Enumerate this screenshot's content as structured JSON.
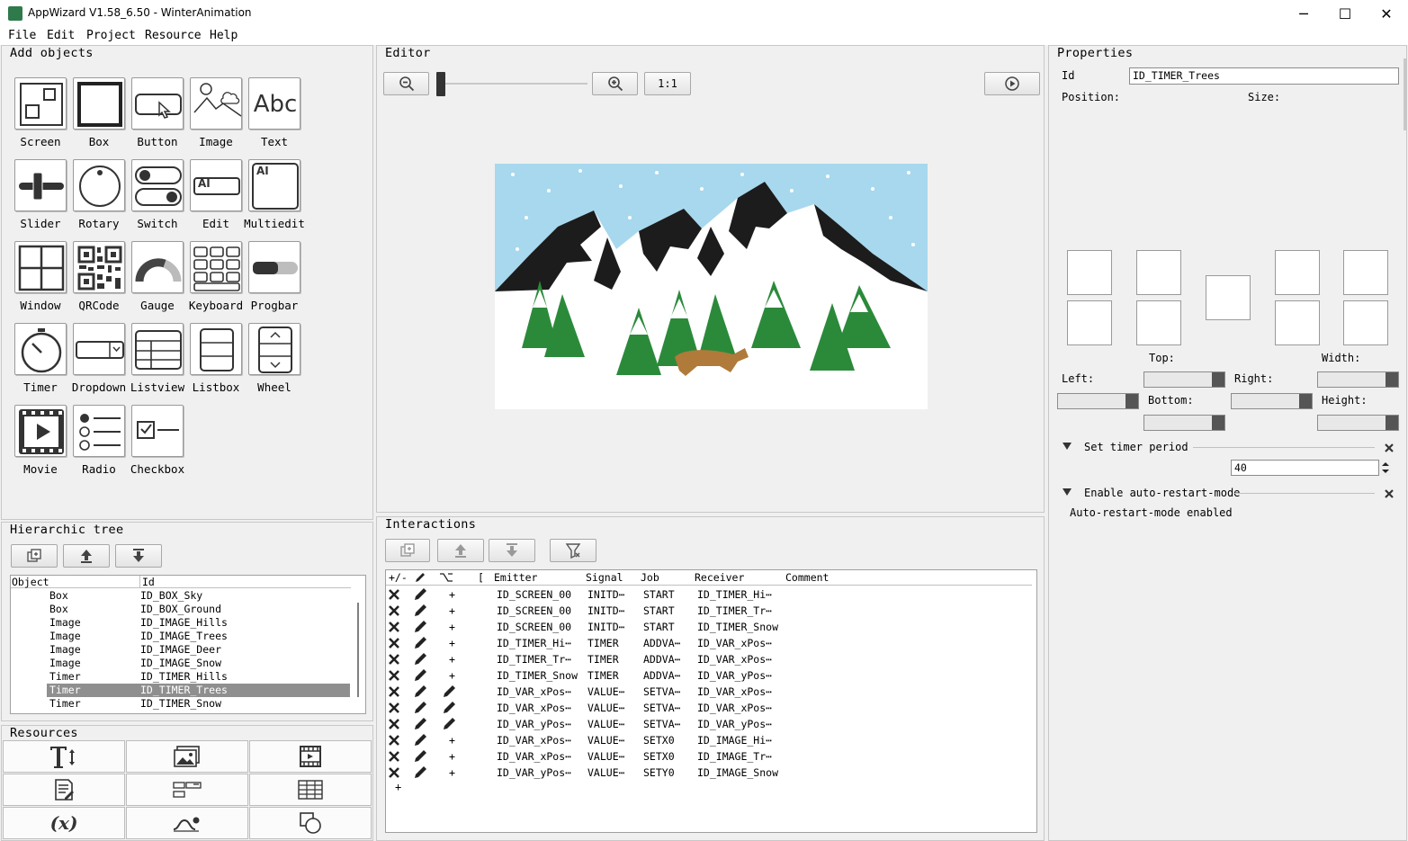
{
  "window": {
    "title": "AppWizard V1.58_6.50 - WinterAnimation",
    "minimize": "─",
    "maximize": "☐",
    "close": "✕"
  },
  "menu": [
    "File",
    "Edit",
    "Project",
    "Resource",
    "Help"
  ],
  "add_objects": {
    "title": "Add objects",
    "items": [
      "Screen",
      "Box",
      "Button",
      "Image",
      "Text",
      "Slider",
      "Rotary",
      "Switch",
      "Edit",
      "Multiedit",
      "Window",
      "QRCode",
      "Gauge",
      "Keyboard",
      "Progbar",
      "Timer",
      "Dropdown",
      "Listview",
      "Listbox",
      "Wheel",
      "Movie",
      "Radio",
      "Checkbox"
    ],
    "text_glyph": "Abc",
    "edit_glyph": "AI",
    "multiedit_glyph": "AI"
  },
  "editor": {
    "title": "Editor",
    "zoom_ratio": "1:1",
    "zoom_level": 0.0
  },
  "properties": {
    "title": "Properties",
    "id_label": "Id",
    "id_value": "ID_TIMER_Trees",
    "position_label": "Position:",
    "size_label": "Size:",
    "top_label": "Top:",
    "width_label": "Width:",
    "left_label": "Left:",
    "right_label": "Right:",
    "bottom_label": "Bottom:",
    "height_label": "Height:",
    "timer_section": "Set timer period",
    "timer_value": "40",
    "auto_section": "Enable auto-restart-mode",
    "auto_text": "Auto-restart-mode enabled"
  },
  "tree": {
    "title": "Hierarchic tree",
    "headers": [
      "Object",
      "Id"
    ],
    "rows": [
      {
        "object": "Box",
        "id": "ID_BOX_Sky",
        "selected": false
      },
      {
        "object": "Box",
        "id": "ID_BOX_Ground",
        "selected": false
      },
      {
        "object": "Image",
        "id": "ID_IMAGE_Hills",
        "selected": false
      },
      {
        "object": "Image",
        "id": "ID_IMAGE_Trees",
        "selected": false
      },
      {
        "object": "Image",
        "id": "ID_IMAGE_Deer",
        "selected": false
      },
      {
        "object": "Image",
        "id": "ID_IMAGE_Snow",
        "selected": false
      },
      {
        "object": "Timer",
        "id": "ID_TIMER_Hills",
        "selected": false
      },
      {
        "object": "Timer",
        "id": "ID_TIMER_Trees",
        "selected": true
      },
      {
        "object": "Timer",
        "id": "ID_TIMER_Snow",
        "selected": false
      }
    ]
  },
  "interactions": {
    "title": "Interactions",
    "headers": [
      "+/-",
      "",
      "",
      "[",
      "Emitter",
      "Signal",
      "Job",
      "Receiver",
      "Comment"
    ],
    "rows": [
      {
        "kind": "+",
        "emitter": "ID_SCREEN_00",
        "signal": "INITD⋯",
        "job": "START",
        "receiver": "ID_TIMER_Hi⋯"
      },
      {
        "kind": "+",
        "emitter": "ID_SCREEN_00",
        "signal": "INITD⋯",
        "job": "START",
        "receiver": "ID_TIMER_Tr⋯"
      },
      {
        "kind": "+",
        "emitter": "ID_SCREEN_00",
        "signal": "INITD⋯",
        "job": "START",
        "receiver": "ID_TIMER_Snow"
      },
      {
        "kind": "+",
        "emitter": "ID_TIMER_Hi⋯",
        "signal": "TIMER",
        "job": "ADDVA⋯",
        "receiver": "ID_VAR_xPos⋯"
      },
      {
        "kind": "+",
        "emitter": "ID_TIMER_Tr⋯",
        "signal": "TIMER",
        "job": "ADDVA⋯",
        "receiver": "ID_VAR_xPos⋯"
      },
      {
        "kind": "+",
        "emitter": "ID_TIMER_Snow",
        "signal": "TIMER",
        "job": "ADDVA⋯",
        "receiver": "ID_VAR_yPos⋯"
      },
      {
        "kind": "edit",
        "emitter": "ID_VAR_xPos⋯",
        "signal": "VALUE⋯",
        "job": "SETVA⋯",
        "receiver": "ID_VAR_xPos⋯"
      },
      {
        "kind": "edit",
        "emitter": "ID_VAR_xPos⋯",
        "signal": "VALUE⋯",
        "job": "SETVA⋯",
        "receiver": "ID_VAR_xPos⋯"
      },
      {
        "kind": "edit",
        "emitter": "ID_VAR_yPos⋯",
        "signal": "VALUE⋯",
        "job": "SETVA⋯",
        "receiver": "ID_VAR_yPos⋯"
      },
      {
        "kind": "+",
        "emitter": "ID_VAR_xPos⋯",
        "signal": "VALUE⋯",
        "job": "SETX0",
        "receiver": "ID_IMAGE_Hi⋯"
      },
      {
        "kind": "+",
        "emitter": "ID_VAR_xPos⋯",
        "signal": "VALUE⋯",
        "job": "SETX0",
        "receiver": "ID_IMAGE_Tr⋯"
      },
      {
        "kind": "+",
        "emitter": "ID_VAR_yPos⋯",
        "signal": "VALUE⋯",
        "job": "SETY0",
        "receiver": "ID_IMAGE_Snow"
      }
    ],
    "add_row": "+"
  },
  "resources": {
    "title": "Resources",
    "formula_glyph": "(x)"
  }
}
